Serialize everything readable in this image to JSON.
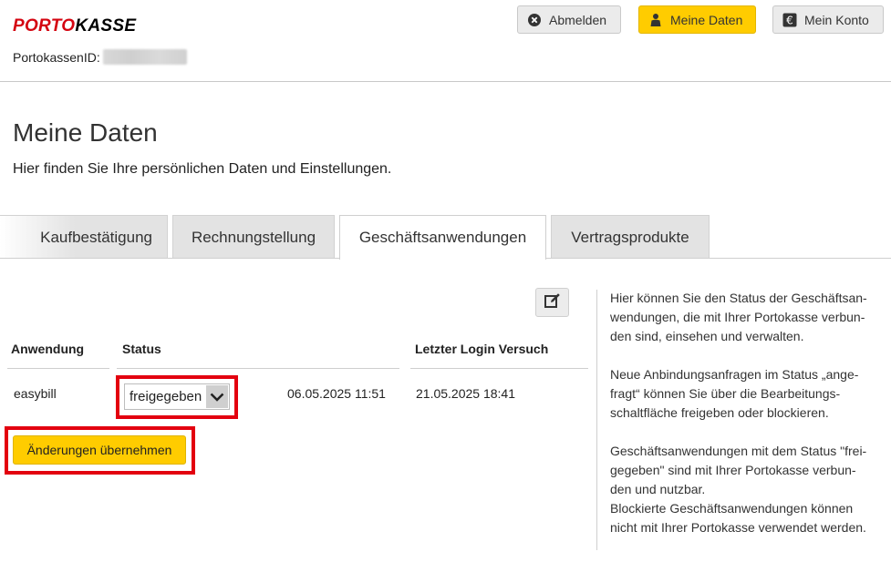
{
  "header": {
    "logo_part1": "PORTO",
    "logo_part2": "KASSE",
    "kasse_id_label": "PortokassenID:",
    "buttons": {
      "logout": "Abmelden",
      "my_data": "Meine Daten",
      "my_account": "Mein Konto"
    }
  },
  "page": {
    "title": "Meine Daten",
    "subtitle": "Hier finden Sie Ihre persönlichen Daten und Einstellungen."
  },
  "tabs": [
    {
      "label": "Kaufbestätigung"
    },
    {
      "label": "Rechnungstellung"
    },
    {
      "label": "Geschäftsanwendungen",
      "active": true
    },
    {
      "label": "Vertragsprodukte"
    }
  ],
  "table": {
    "headers": {
      "application": "Anwendung",
      "status": "Status",
      "last_login": "Letzter Login Versuch"
    },
    "rows": [
      {
        "application": "easybill",
        "status": "freigegeben",
        "date": "06.05.2025 11:51",
        "last_login": "21.05.2025 18:41"
      }
    ]
  },
  "apply_button": "Änderungen übernehmen",
  "help": {
    "p1_l1": "Hier können Sie den Status der Geschäftsan-",
    "p1_l2": "wendungen, die mit Ihrer Portokasse verbun-",
    "p1_l3": "den sind, einsehen und verwalten.",
    "p2_l1": "Neue Anbindungsanfragen im Status „ange-",
    "p2_l2": "fragt“ können Sie über die Bearbeitungs-",
    "p2_l3": "schaltfläche freigeben oder blockieren.",
    "p3_l1": "Geschäftsanwendungen mit dem Status \"frei-",
    "p3_l2": "gegeben\" sind mit Ihrer Portokasse verbun-",
    "p3_l3": "den und nutzbar.",
    "p4_l1": "Blockierte Geschäftsanwendungen können",
    "p4_l2": "nicht mit Ihrer Portokasse verwendet werden."
  },
  "colors": {
    "brand_red": "#d40511",
    "brand_yellow": "#ffcc00",
    "highlight_red": "#e3000f"
  },
  "icons": {
    "logout": "close-circle-icon",
    "my_data": "person-icon",
    "my_account": "euro-icon",
    "edit": "edit-icon",
    "select_arrow": "chevron-down-icon"
  }
}
